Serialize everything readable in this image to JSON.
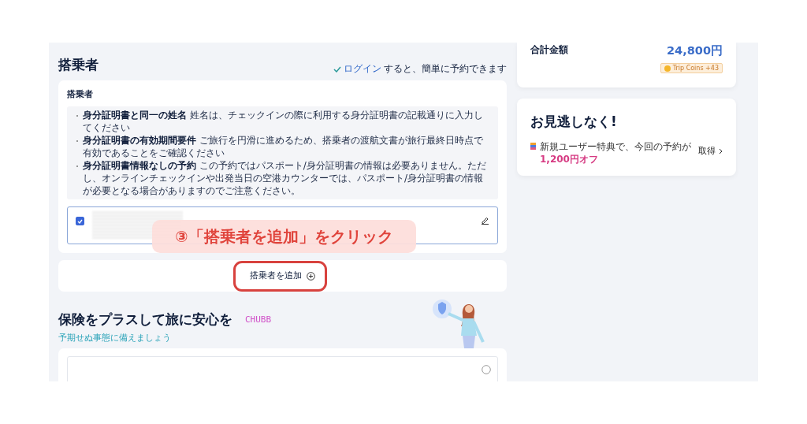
{
  "passengers_section": {
    "title": "搭乗者",
    "login_hint": {
      "link": "ログイン",
      "text": "すると、簡単に予約できます"
    },
    "card_title": "搭乗者",
    "notices": [
      {
        "text": "**身分証明書と同一の姓名** 姓名は、チェックインの際に利用する身分証明書の記載通りに入力してください"
      },
      {
        "text": "**身分証明書の有効期間要件** ご旅行を円滑に進めるため、搭乗者の渡航文書が旅行最終日時点で有効であることをご確認ください"
      },
      {
        "text": "**身分証明書情報なしの予約** この予約ではパスポート/身分証明書の情報は必要ありません。ただし、オンラインチェックインや出発当日の空港カウンターでは、パスポート/身分証明書の情報が必要となる場合がありますのでご注意ください。"
      }
    ],
    "passengers": [
      {
        "checked": true
      }
    ],
    "add_button": "搭乗者を追加"
  },
  "annotation": {
    "text": "③「搭乗者を追加」をクリック"
  },
  "insurance": {
    "title": "保険をプラスして旅に安心を",
    "brand": "CHUBB",
    "subtitle": "予期せぬ事態に備えましょう"
  },
  "summary": {
    "total_label": "合計金額",
    "total_value": "24,800円",
    "coins": "Trip Coins +43"
  },
  "promo": {
    "title": "お見逃しなく!",
    "text": "新規ユーザー特典で、今回の予約が**1,200円オフ**",
    "action": "取得"
  }
}
